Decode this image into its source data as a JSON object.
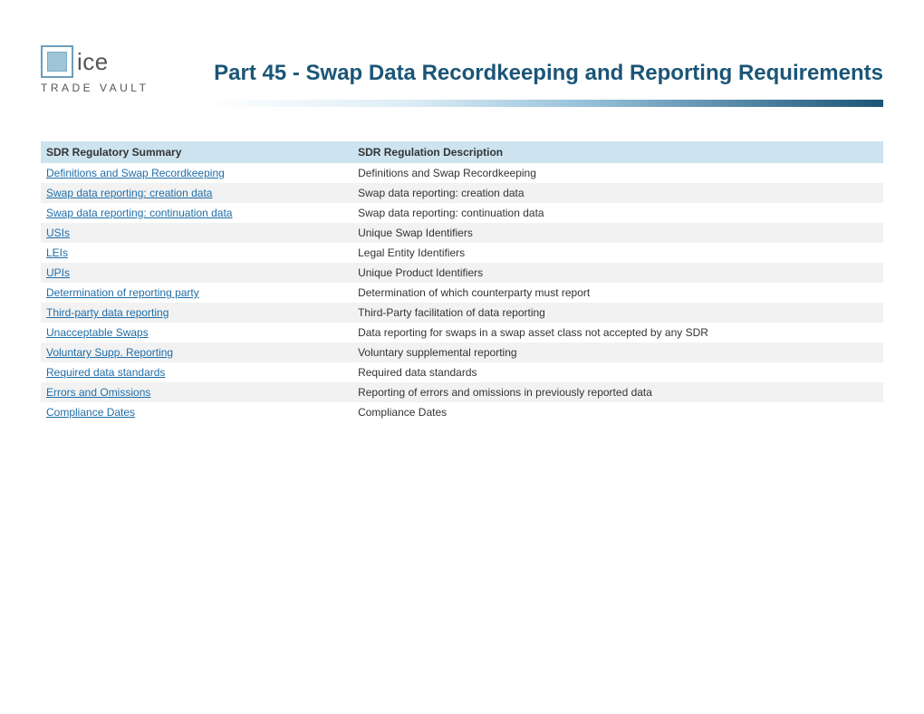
{
  "logo": {
    "brand": "ice",
    "sub": "TRADE VAULT"
  },
  "title": "Part 45 - Swap Data Recordkeeping and Reporting Requirements",
  "table": {
    "headers": {
      "summary": "SDR Regulatory Summary",
      "description": "SDR Regulation Description"
    },
    "rows": [
      {
        "summary": "Definitions and Swap Recordkeeping",
        "description": "Definitions and Swap Recordkeeping"
      },
      {
        "summary": "Swap data reporting: creation data",
        "description": "Swap data reporting: creation data"
      },
      {
        "summary": "Swap data reporting: continuation data",
        "description": "Swap data reporting: continuation data"
      },
      {
        "summary": "USIs",
        "description": "Unique Swap Identifiers"
      },
      {
        "summary": "LEIs",
        "description": "Legal Entity Identifiers"
      },
      {
        "summary": "UPIs",
        "description": "Unique Product Identifiers"
      },
      {
        "summary": "Determination of reporting party",
        "description": "Determination of which counterparty must report"
      },
      {
        "summary": "Third-party data reporting",
        "description": "Third-Party facilitation of data reporting"
      },
      {
        "summary": "Unacceptable Swaps",
        "description": "Data reporting for swaps in a swap asset class not accepted by any SDR"
      },
      {
        "summary": "Voluntary Supp. Reporting",
        "description": "Voluntary supplemental reporting"
      },
      {
        "summary": "Required data standards",
        "description": "Required data standards"
      },
      {
        "summary": "Errors and Omissions",
        "description": "Reporting of errors and omissions in previously reported data"
      },
      {
        "summary": "Compliance Dates",
        "description": "Compliance Dates"
      }
    ]
  }
}
